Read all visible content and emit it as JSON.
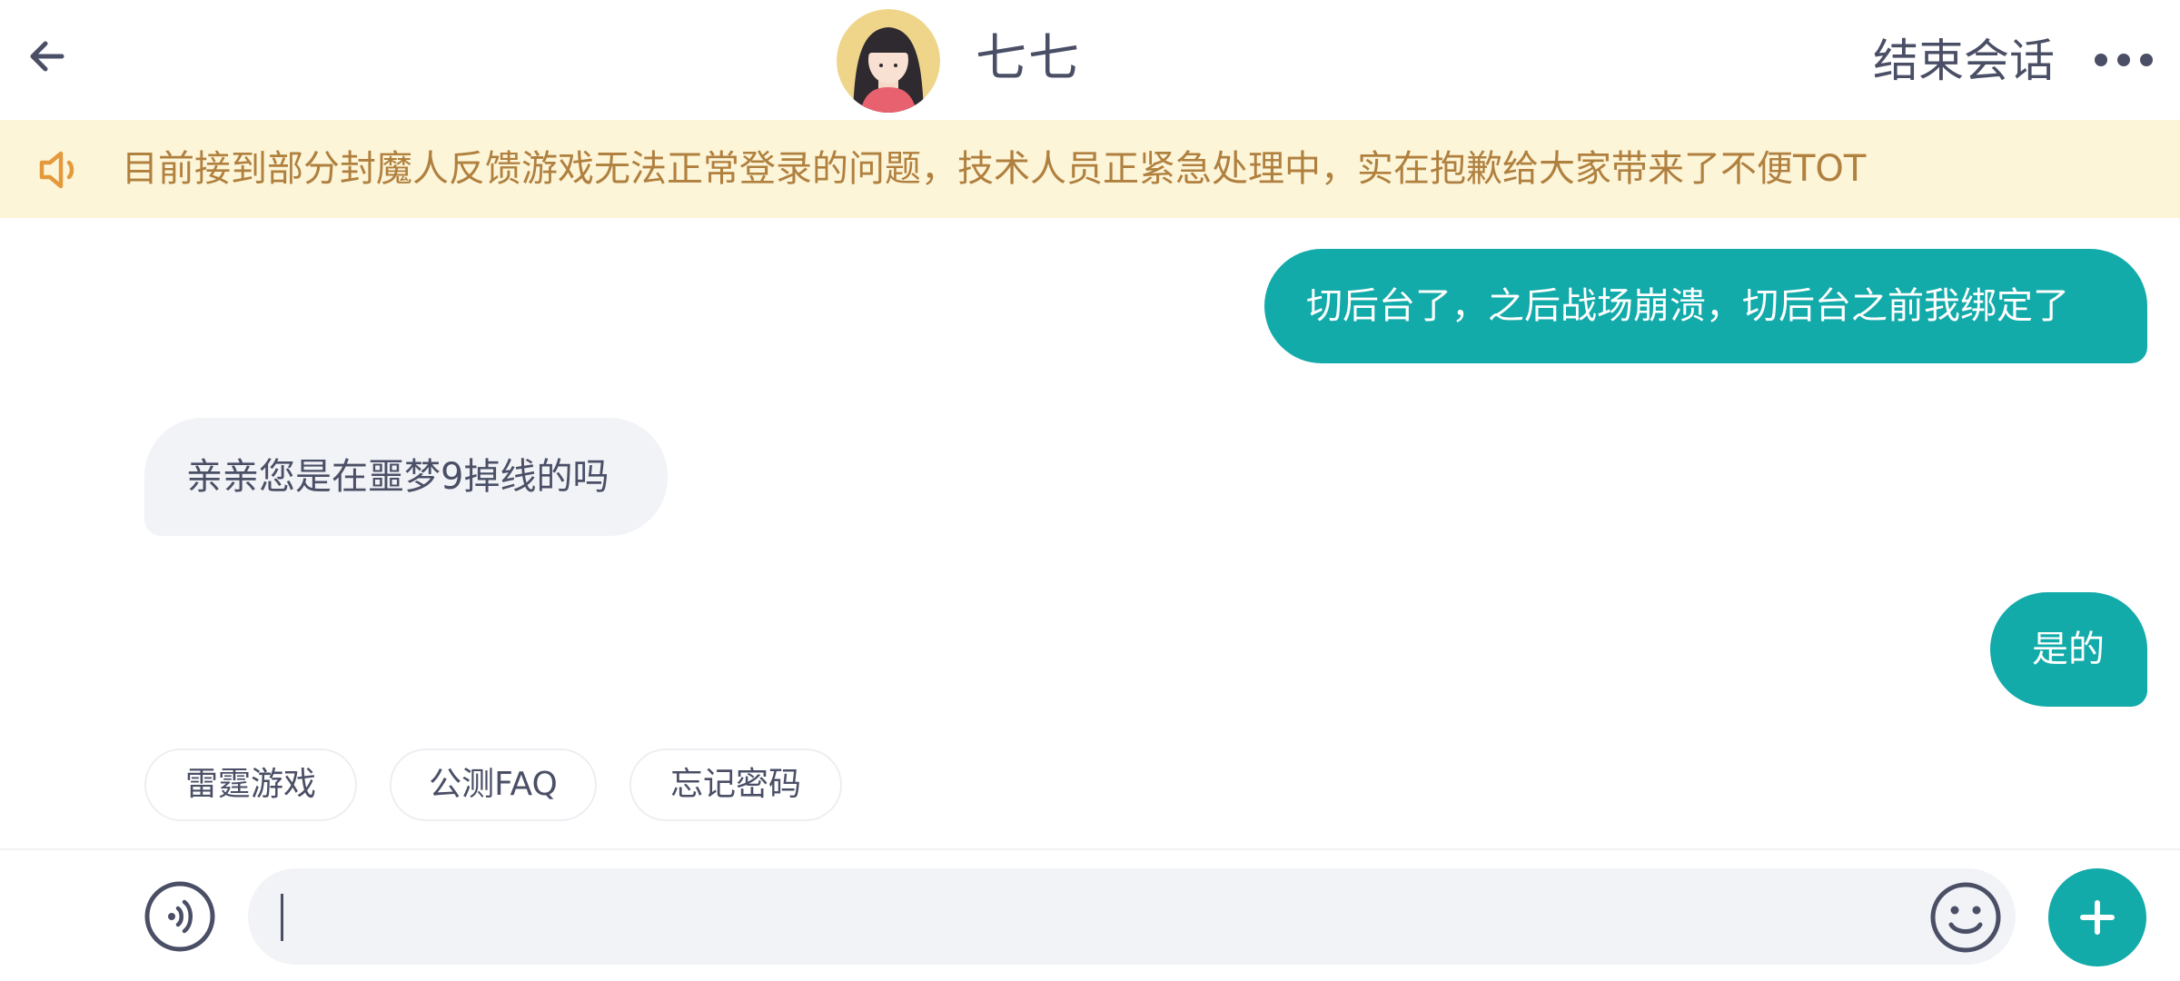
{
  "header": {
    "agent_name": "七七",
    "end_session_label": "结束会话",
    "back_icon": "arrow-left-icon",
    "more_icon": "more-dots-icon"
  },
  "notice": {
    "icon": "speaker-icon",
    "text": "目前接到部分封魔人反馈游戏无法正常登录的问题，技术人员正紧急处理中，实在抱歉给大家带来了不便TOT"
  },
  "messages": [
    {
      "from": "user",
      "text": "切后台了，之后战场崩溃，切后台之前我绑定了"
    },
    {
      "from": "agent",
      "text": "亲亲您是在噩梦9掉线的吗"
    },
    {
      "from": "user",
      "text": "是的"
    }
  ],
  "quick_replies": [
    {
      "label": "雷霆游戏"
    },
    {
      "label": "公测FAQ"
    },
    {
      "label": "忘记密码"
    }
  ],
  "input": {
    "value": "",
    "voice_icon": "voice-icon",
    "emoji_icon": "emoji-icon",
    "plus_icon": "plus-icon"
  },
  "colors": {
    "accent": "#13aaaa",
    "notice_bg": "#fdf5d8",
    "notice_text": "#b0803f",
    "text": "#4a4f66",
    "bubble_in": "#f1f3f7"
  }
}
